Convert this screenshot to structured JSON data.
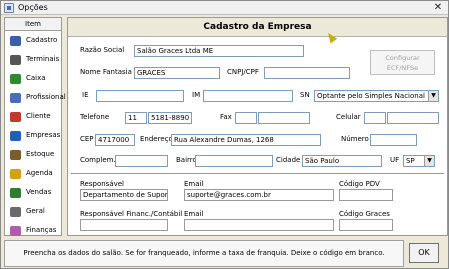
{
  "window": {
    "title": "Opções"
  },
  "sidebar": {
    "header": "Item",
    "items": [
      {
        "label": "Cadastro",
        "icon": "book-icon",
        "color": "#3a5fa8"
      },
      {
        "label": "Terminais",
        "icon": "terminal-icon",
        "color": "#555555"
      },
      {
        "label": "Caixa",
        "icon": "cash-register-icon",
        "color": "#2f8a2f"
      },
      {
        "label": "Profissional",
        "icon": "id-card-icon",
        "color": "#4b6cb7"
      },
      {
        "label": "Cliente",
        "icon": "person-icon",
        "color": "#c0392b"
      },
      {
        "label": "Empresas",
        "icon": "info-icon",
        "color": "#1f5fb5"
      },
      {
        "label": "Estoque",
        "icon": "boxes-icon",
        "color": "#7a5c2e"
      },
      {
        "label": "Agenda",
        "icon": "calendar-icon",
        "color": "#d4a017"
      },
      {
        "label": "Vendas",
        "icon": "cart-icon",
        "color": "#2e7d32"
      },
      {
        "label": "Geral",
        "icon": "settings-icon",
        "color": "#6a6a6a"
      },
      {
        "label": "Finanças",
        "icon": "coins-icon",
        "color": "#b05bb0"
      }
    ]
  },
  "panel": {
    "title": "Cadastro da Empresa",
    "razao_social": {
      "label": "Razão Social",
      "value": "Salão Graces Ltda ME"
    },
    "nome_fantasia": {
      "label": "Nome Fantasia",
      "value": "GRACES"
    },
    "cnpj": {
      "label": "CNPJ/CPF",
      "value": ""
    },
    "config_button": {
      "line1": "Configurar",
      "line2": "ECF/NFSe"
    },
    "ie": {
      "label": "IE",
      "value": ""
    },
    "im": {
      "label": "IM",
      "value": ""
    },
    "sn": {
      "label": "SN",
      "value": "Optante pelo Simples Nacional"
    },
    "telefone": {
      "label": "Telefone",
      "ddd": "11",
      "number": "5181-8890"
    },
    "fax": {
      "label": "Fax",
      "value": ""
    },
    "celular": {
      "label": "Celular",
      "value": ""
    },
    "cep": {
      "label": "CEP",
      "value": "4717000"
    },
    "endereco": {
      "label": "Endereço",
      "value": "Rua Alexandre Dumas, 1268"
    },
    "numero": {
      "label": "Número",
      "value": ""
    },
    "complemento": {
      "label": "Complem.",
      "value": ""
    },
    "bairro": {
      "label": "Bairro",
      "value": ""
    },
    "cidade": {
      "label": "Cidade",
      "value": "São Paulo"
    },
    "uf": {
      "label": "UF",
      "value": "SP"
    },
    "responsavel": {
      "label": "Responsável",
      "value": "Departamento de Suporte"
    },
    "email": {
      "label": "Email",
      "value": "suporte@graces.com.br"
    },
    "codigo_pdv": {
      "label": "Código PDV",
      "value": ""
    },
    "resp_financ": {
      "label": "Responsável Financ./Contábil",
      "value": ""
    },
    "email2": {
      "label": "Email",
      "value": ""
    },
    "codigo_graces": {
      "label": "Código Graces",
      "value": ""
    }
  },
  "footer": {
    "hint": "Preencha os dados do salão. Se for franqueado, informe a taxa de franquia. Deixe o código em branco.",
    "ok_label": "OK"
  }
}
